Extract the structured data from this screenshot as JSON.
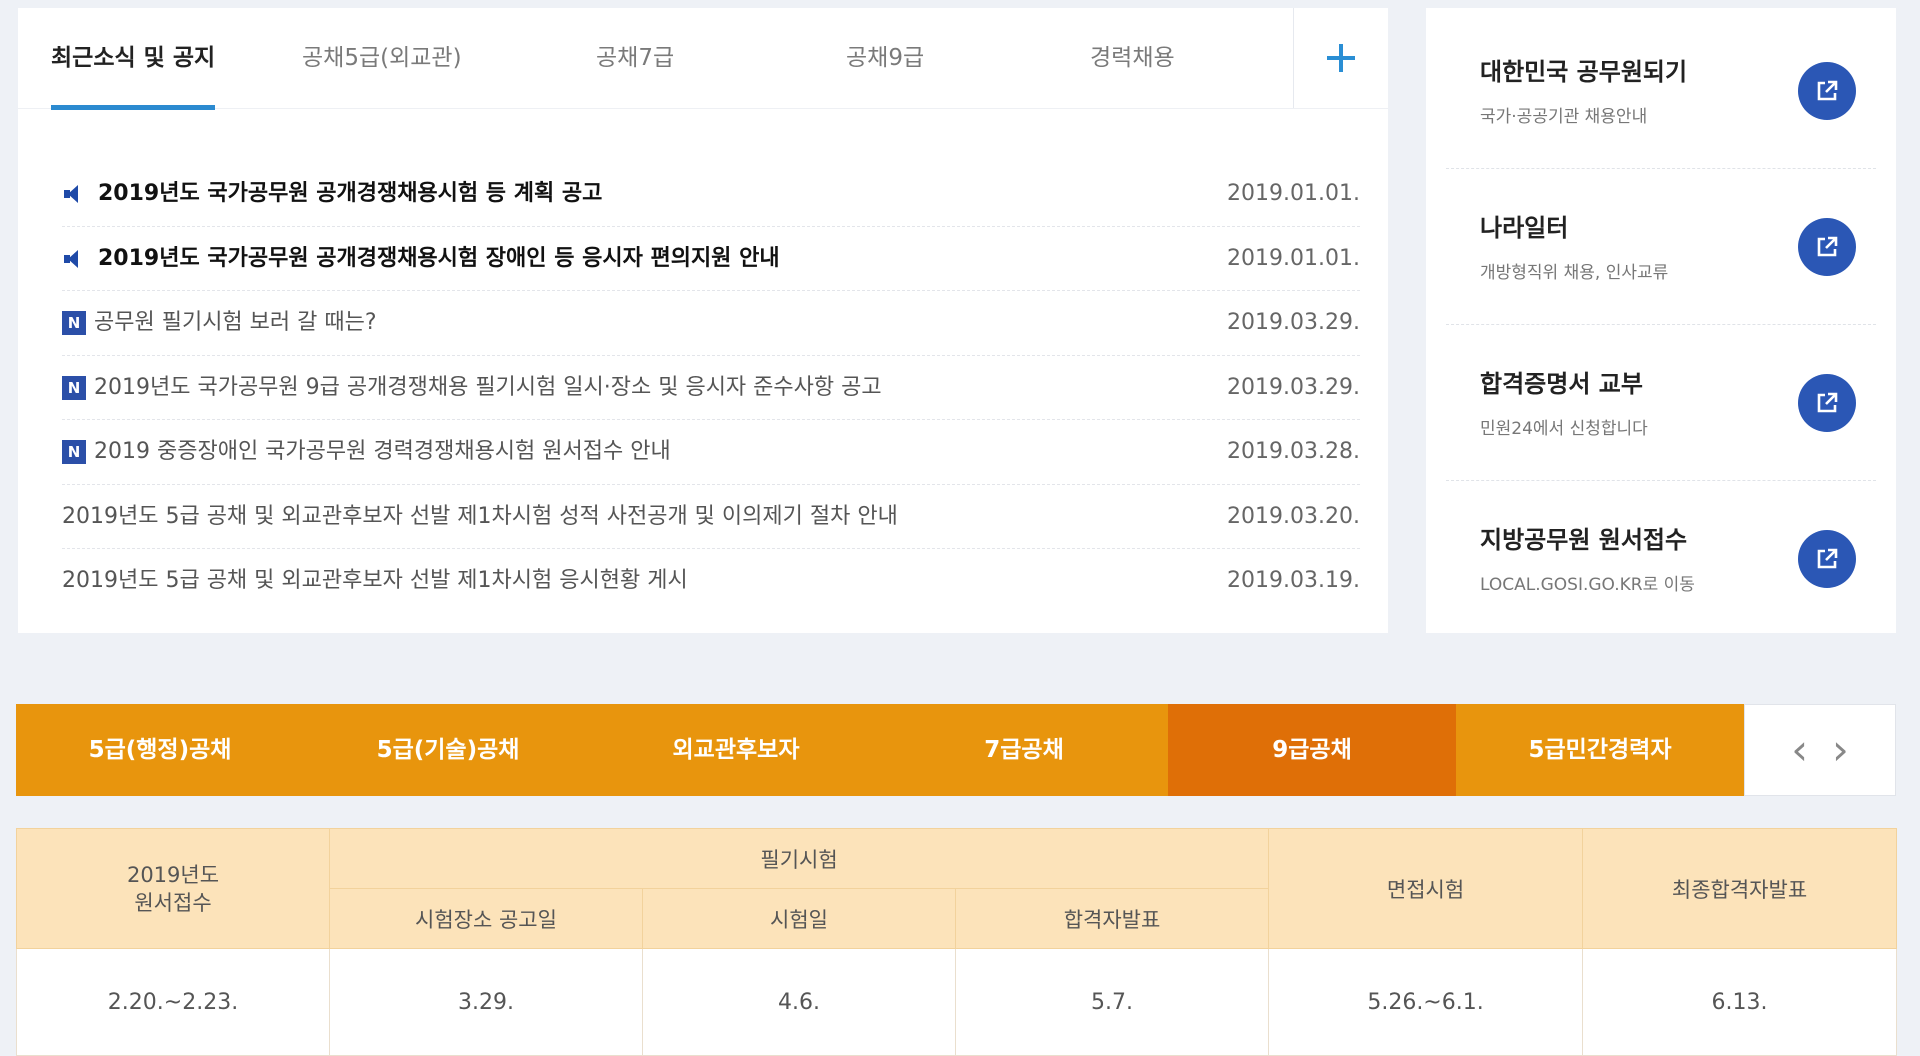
{
  "tabs": [
    {
      "label": "최근소식 및 공지",
      "active": true
    },
    {
      "label": "공채5급(외교관)",
      "active": false
    },
    {
      "label": "공채7급",
      "active": false
    },
    {
      "label": "공채9급",
      "active": false
    },
    {
      "label": "경력채용",
      "active": false
    }
  ],
  "more_icon": "plus-icon",
  "notices": [
    {
      "title": "2019년도 국가공무원 공개경쟁채용시험 등 계획 공고",
      "date": "2019.01.01.",
      "marker": "speaker-icon"
    },
    {
      "title": "2019년도 국가공무원 공개경쟁채용시험 장애인 등 응시자 편의지원 안내",
      "date": "2019.01.01.",
      "marker": "speaker-icon"
    },
    {
      "title": "공무원 필기시험 보러 갈 때는?",
      "date": "2019.03.29.",
      "marker": "new-badge",
      "badge": "N"
    },
    {
      "title": "2019년도 국가공무원 9급 공개경쟁채용 필기시험 일시·장소 및 응시자 준수사항 공고",
      "date": "2019.03.29.",
      "marker": "new-badge",
      "badge": "N"
    },
    {
      "title": "2019 중증장애인 국가공무원 경력경쟁채용시험 원서접수 안내",
      "date": "2019.03.28.",
      "marker": "new-badge",
      "badge": "N"
    },
    {
      "title": "2019년도 5급 공채 및 외교관후보자 선발 제1차시험 성적 사전공개 및 이의제기 절차 안내",
      "date": "2019.03.20.",
      "marker": "none"
    },
    {
      "title": "2019년도 5급 공채 및 외교관후보자 선발 제1차시험 응시현황 게시",
      "date": "2019.03.19.",
      "marker": "none"
    }
  ],
  "side_links": [
    {
      "title": "대한민국 공무원되기",
      "desc": "국가·공공기관 채용안내",
      "icon": "external-link-icon"
    },
    {
      "title": "나라일터",
      "desc": "개방형직위 채용, 인사교류",
      "icon": "external-link-icon"
    },
    {
      "title": "합격증명서 교부",
      "desc": "민원24에서 신청합니다",
      "icon": "external-link-icon"
    },
    {
      "title": "지방공무원 원서접수",
      "desc": "LOCAL.GOSI.GO.KR로 이동",
      "icon": "external-link-icon"
    }
  ],
  "categories": [
    {
      "label": "5급(행정)공채",
      "active": false
    },
    {
      "label": "5급(기술)공채",
      "active": false
    },
    {
      "label": "외교관후보자",
      "active": false
    },
    {
      "label": "7급공채",
      "active": false
    },
    {
      "label": "9급공채",
      "active": true
    },
    {
      "label": "5급민간경력자",
      "active": false
    }
  ],
  "category_nav": {
    "prev": "‹",
    "next": "›"
  },
  "schedule": {
    "col_application": "2019년도\n원서접수",
    "col_written": "필기시험",
    "col_written_sub": [
      "시험장소 공고일",
      "시험일",
      "합격자발표"
    ],
    "col_interview": "면접시험",
    "col_final": "최종합격자발표",
    "row": [
      "2.20.~2.23.",
      "3.29.",
      "4.6.",
      "5.7.",
      "5.26.~6.1.",
      "6.13."
    ]
  },
  "colors": {
    "accent_blue": "#2b8ad0",
    "category_orange": "#e8950d",
    "category_active": "#df6f07",
    "table_header": "#fce3ba"
  }
}
